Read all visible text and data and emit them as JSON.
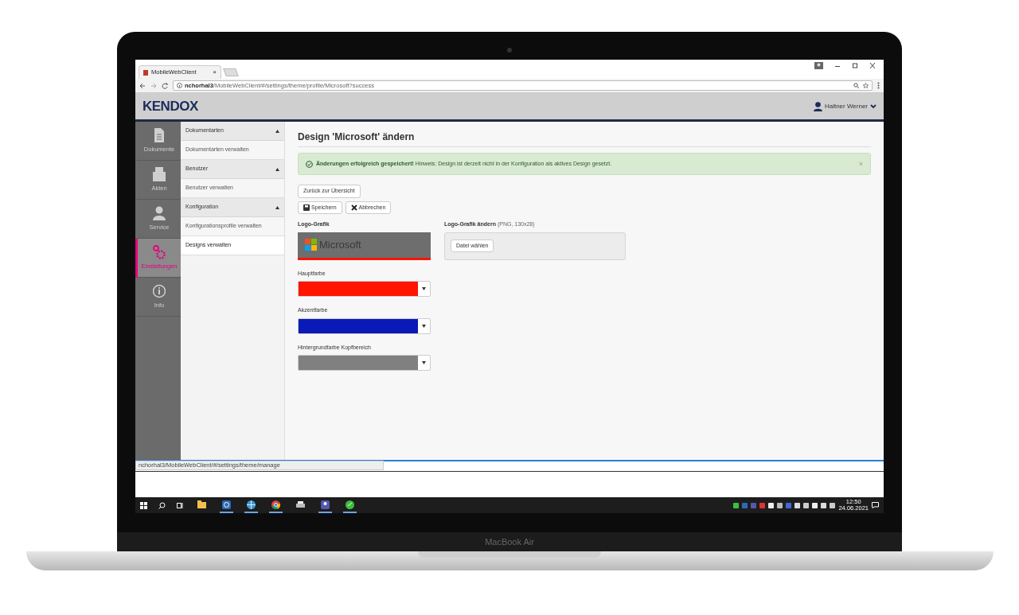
{
  "laptop": {
    "label": "MacBook Air"
  },
  "browser": {
    "tab": {
      "title": "MobileWebClient",
      "close": "×"
    },
    "address": {
      "host": "nchorhal3",
      "path": "/MobileWebClient/#/settings/theme/profile/Microsoft?success"
    },
    "status_url": "nchorhal3/MobileWebClient/#/settings/theme/manage"
  },
  "app": {
    "logo": "KENDOX",
    "user": "Haltner Werner"
  },
  "nav": [
    {
      "kind": "document",
      "label": "Dokumente",
      "selected": false
    },
    {
      "kind": "folder",
      "label": "Akten",
      "selected": false
    },
    {
      "kind": "person",
      "label": "Service",
      "selected": false
    },
    {
      "kind": "gears",
      "label": "Einstellungen",
      "selected": true
    },
    {
      "kind": "info",
      "label": "Info",
      "selected": false
    }
  ],
  "submenu": [
    {
      "label": "Dokumentarten",
      "expanded": true,
      "children": [
        {
          "label": "Dokumentarten verwalten",
          "selected": false
        }
      ]
    },
    {
      "label": "Benutzer",
      "expanded": true,
      "children": [
        {
          "label": "Benutzer verwalten",
          "selected": false
        }
      ]
    },
    {
      "label": "Konfiguration",
      "expanded": true,
      "children": [
        {
          "label": "Konfigurationsprofile verwalten",
          "selected": false
        },
        {
          "label": "Designs verwalten",
          "selected": true
        }
      ]
    }
  ],
  "page": {
    "title": "Design 'Microsoft' ändern",
    "alert": {
      "message": "**Änderungen erfolgreich gespeichert!** Hinweis: Design ist derzeit nicht in der Konfiguration als aktives Design gesetzt.",
      "close": "×"
    },
    "back_button": "Zurück zur Übersicht",
    "save_button": "Speichern",
    "cancel_button": "Abbrechen",
    "logo_label": "Logo-Grafik",
    "logo_text": "Microsoft",
    "upload_label": "Logo-Grafik ändern",
    "upload_hint": "(PNG, 130x28)",
    "upload_button": "Datei wählen",
    "colors": [
      {
        "label": "Hauptfarbe",
        "color": "#ff1400"
      },
      {
        "label": "Akzentfarbe",
        "color": "#0a1ab8"
      },
      {
        "label": "Hintergrundfarbe Kopfbereich",
        "color": "#808080"
      }
    ]
  },
  "taskbar": {
    "apps": [
      {
        "kind": "folder",
        "selected": false
      },
      {
        "kind": "remote",
        "selected": true
      },
      {
        "kind": "globe",
        "selected": true
      },
      {
        "kind": "chrome",
        "selected": true
      },
      {
        "kind": "printer",
        "selected": false
      },
      {
        "kind": "people",
        "selected": true
      },
      {
        "kind": "green",
        "selected": true
      }
    ],
    "time": "12:50",
    "date": "24.06.2021"
  }
}
